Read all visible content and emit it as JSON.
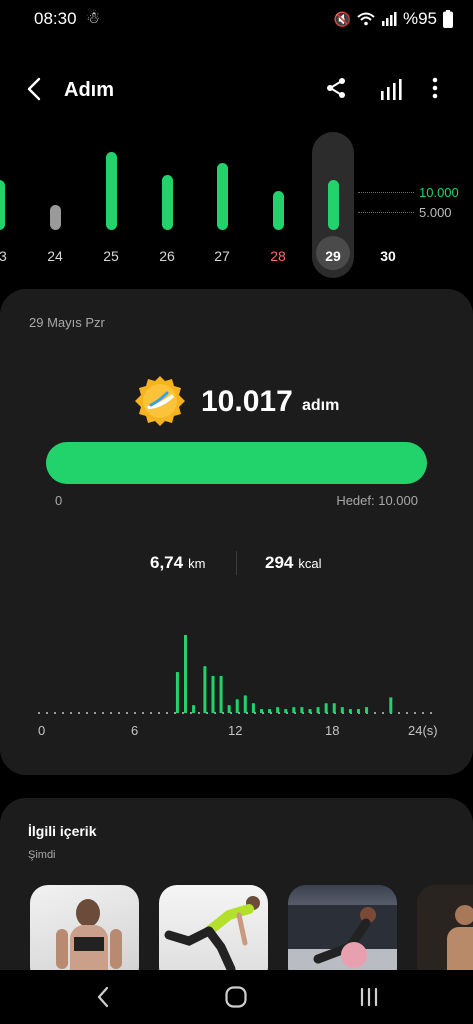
{
  "status_bar": {
    "time": "08:30",
    "battery": "%95"
  },
  "header": {
    "title": "Adım"
  },
  "week_chart": {
    "goal_high_label": "10.000",
    "goal_low_label": "5.000",
    "days": [
      {
        "label": "23",
        "steps_k": 10.0,
        "color": "#22d36b"
      },
      {
        "label": "24",
        "steps_k": 5.1,
        "color": "#9a9a9a"
      },
      {
        "label": "25",
        "steps_k": 15.7,
        "color": "#22d36b"
      },
      {
        "label": "26",
        "steps_k": 11.0,
        "color": "#22d36b"
      },
      {
        "label": "27",
        "steps_k": 13.5,
        "color": "#22d36b"
      },
      {
        "label": "28",
        "steps_k": 7.8,
        "color": "#22d36b",
        "weekend": true
      },
      {
        "label": "29",
        "steps_k": 10.0,
        "color": "#22d36b",
        "selected": true
      },
      {
        "label": "30",
        "steps_k": 0,
        "color": "#22d36b"
      }
    ]
  },
  "summary": {
    "date": "29 Mayıs Pzr",
    "steps_value": "10.017",
    "steps_unit": "adım",
    "progress_fraction": 1.0,
    "progress_min": "0",
    "progress_goal": "Hedef: 10.000",
    "distance_value": "6,74",
    "distance_unit": "km",
    "calories_value": "294",
    "calories_unit": "kcal"
  },
  "chart_data": {
    "type": "bar",
    "x_tick_labels": [
      "0",
      "6",
      "12",
      "18",
      "24(s)"
    ],
    "x": [
      8.5,
      9,
      9.5,
      10.2,
      10.7,
      11.2,
      11.7,
      12.2,
      12.7,
      13.2,
      13.7,
      14.2,
      14.7,
      15.2,
      15.7,
      16.2,
      16.7,
      17.2,
      17.7,
      18.2,
      18.7,
      19.2,
      19.7,
      20.2,
      21.7
    ],
    "values": [
      42,
      80,
      8,
      48,
      38,
      38,
      8,
      14,
      18,
      10,
      4,
      4,
      6,
      4,
      6,
      6,
      4,
      6,
      10,
      10,
      6,
      4,
      4,
      6,
      16
    ],
    "xlim": [
      0,
      24
    ]
  },
  "related": {
    "title": "İlgili içerik",
    "subtitle": "Şimdi",
    "items": [
      "thumb-1",
      "thumb-2",
      "thumb-3",
      "thumb-4"
    ]
  }
}
